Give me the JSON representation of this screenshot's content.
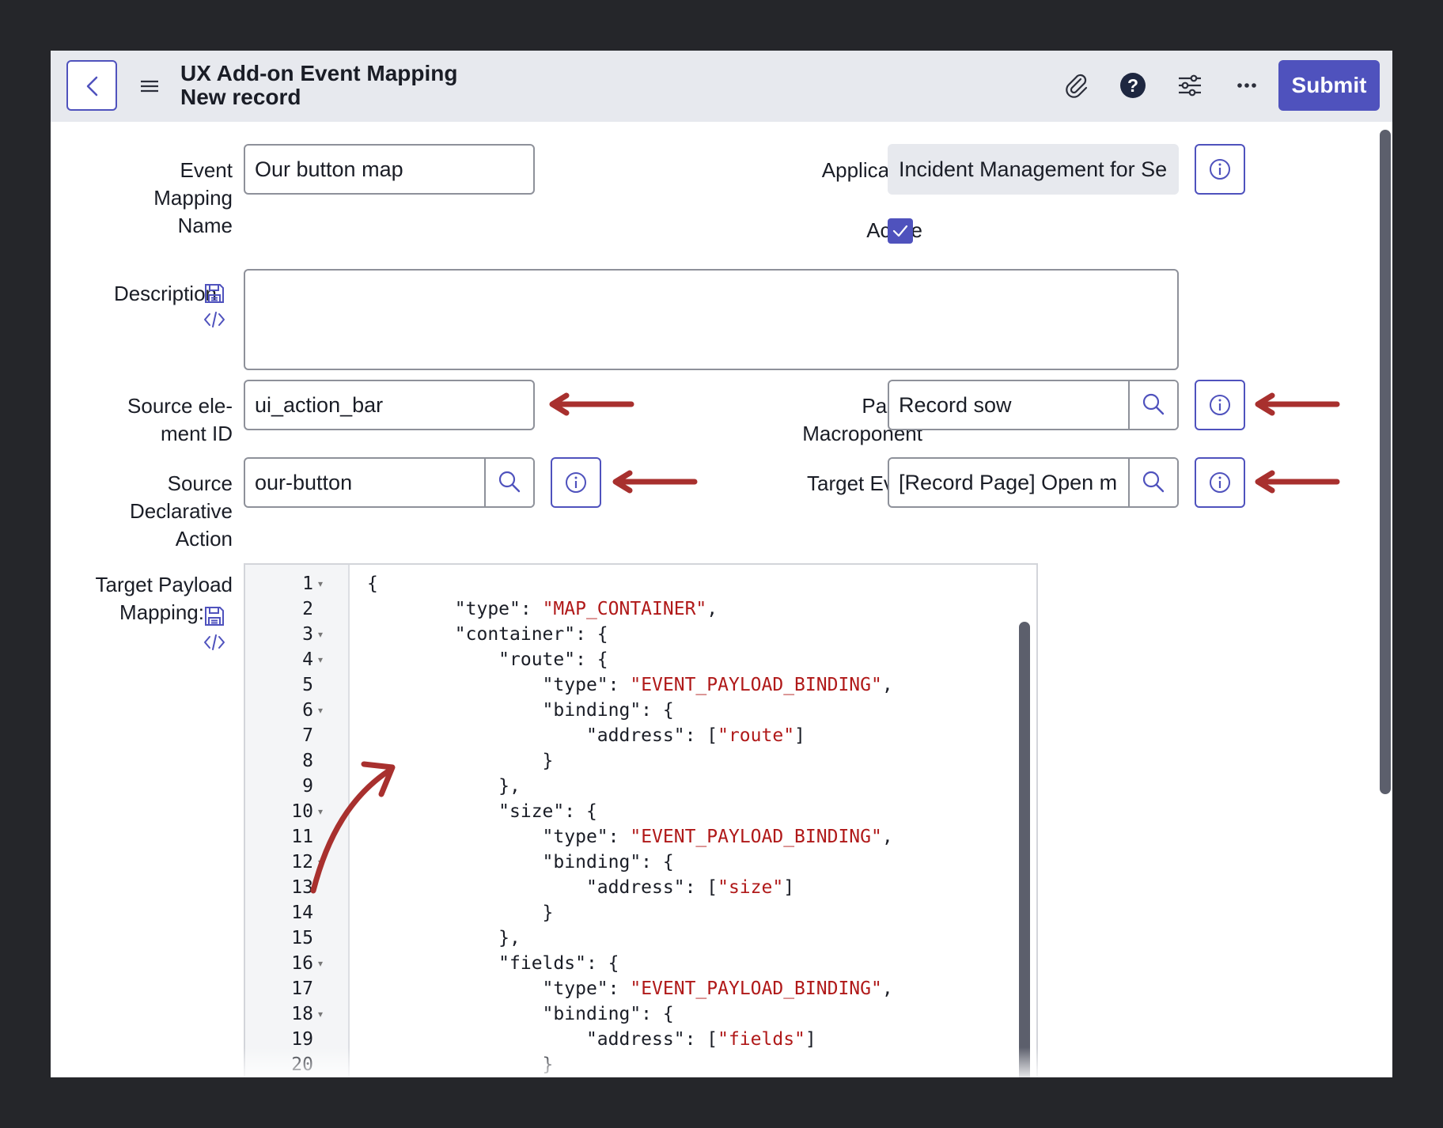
{
  "header": {
    "title": "UX Add-on Event Mapping",
    "subtitle": "New record",
    "submit_label": "Submit"
  },
  "form": {
    "event_mapping_name": {
      "label_lines": [
        "Event",
        "Mapping",
        "Name"
      ],
      "value": "Our button map"
    },
    "application": {
      "label": "Application",
      "value": "Incident Management for Se"
    },
    "active": {
      "label": "Active",
      "checked": true
    },
    "description": {
      "label": "Description",
      "value": ""
    },
    "source_element_id": {
      "label_lines": [
        "Source ele-",
        "ment ID"
      ],
      "value": "ui_action_bar"
    },
    "parent_macroponent": {
      "label_lines": [
        "Parent",
        "Macroponent"
      ],
      "value": "Record sow"
    },
    "source_declarative_action": {
      "label_lines": [
        "Source",
        "Declarative",
        "Action"
      ],
      "value": "our-button"
    },
    "target_event": {
      "label": "Target Event",
      "value": "[Record Page] Open m"
    },
    "target_payload_mapping": {
      "label_lines": [
        "Target Payload",
        "Mapping:"
      ]
    }
  },
  "editor": {
    "line_numbers": [
      "1",
      "2",
      "3",
      "4",
      "5",
      "6",
      "7",
      "8",
      "9",
      "10",
      "11",
      "12",
      "13",
      "14",
      "15",
      "16",
      "17",
      "18",
      "19",
      "20"
    ],
    "fold_lines": [
      1,
      3,
      4,
      6,
      10,
      12,
      16,
      18
    ],
    "lines": [
      {
        "pre": "{"
      },
      {
        "pre": "        \"type\": ",
        "str": "\"MAP_CONTAINER\"",
        "post": ","
      },
      {
        "pre": "        \"container\": {"
      },
      {
        "pre": "            \"route\": {"
      },
      {
        "pre": "                \"type\": ",
        "str": "\"EVENT_PAYLOAD_BINDING\"",
        "post": ","
      },
      {
        "pre": "                \"binding\": {"
      },
      {
        "pre": "                    \"address\": [",
        "str": "\"route\"",
        "post": "]"
      },
      {
        "pre": "                }"
      },
      {
        "pre": "            },"
      },
      {
        "pre": "            \"size\": {"
      },
      {
        "pre": "                \"type\": ",
        "str": "\"EVENT_PAYLOAD_BINDING\"",
        "post": ","
      },
      {
        "pre": "                \"binding\": {"
      },
      {
        "pre": "                    \"address\": [",
        "str": "\"size\"",
        "post": "]"
      },
      {
        "pre": "                }"
      },
      {
        "pre": "            },"
      },
      {
        "pre": "            \"fields\": {"
      },
      {
        "pre": "                \"type\": ",
        "str": "\"EVENT_PAYLOAD_BINDING\"",
        "post": ","
      },
      {
        "pre": "                \"binding\": {"
      },
      {
        "pre": "                    \"address\": [",
        "str": "\"fields\"",
        "post": "]"
      },
      {
        "pre": "                }"
      }
    ]
  },
  "colors": {
    "accent": "#4f52bd",
    "annotation_arrow": "#a8302e",
    "code_string": "#b01919",
    "header_bg": "#e7e9ee"
  },
  "icons": [
    "chevron-left-icon",
    "hamburger-menu-icon",
    "paperclip-icon",
    "help-icon",
    "sliders-icon",
    "more-icon",
    "info-icon",
    "search-icon",
    "check-icon",
    "save-icon",
    "code-icon",
    "annotation-arrow"
  ]
}
